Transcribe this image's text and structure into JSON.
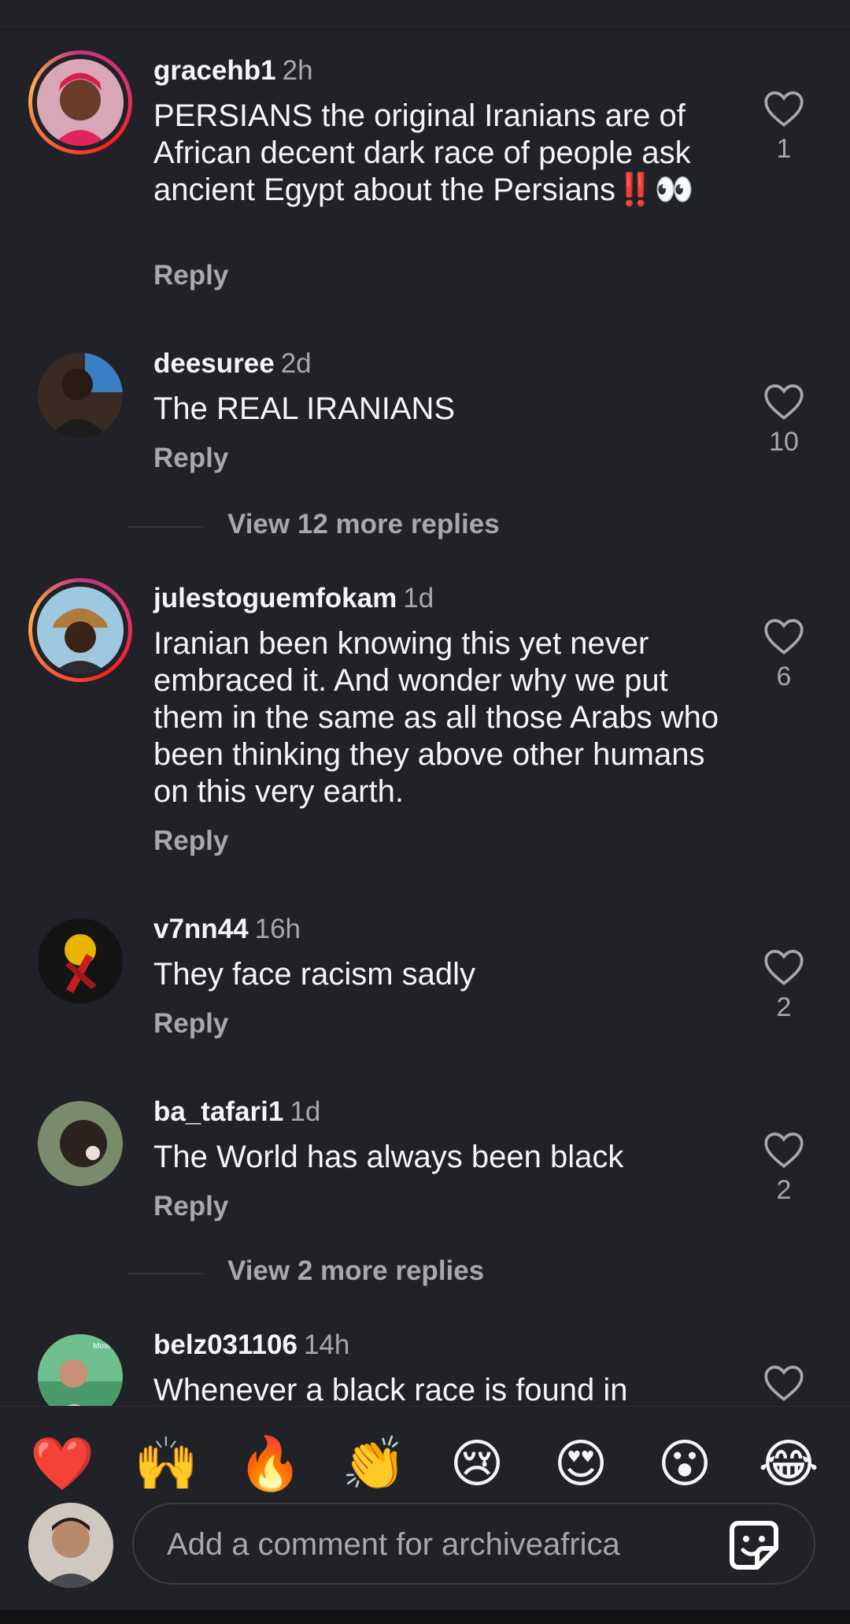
{
  "comments": [
    {
      "username": "gracehb1",
      "time": "2h",
      "text": "PERSIANS the original Iranians are of African decent dark race of people ask ancient Egypt about the Persians",
      "text_emoji": "‼️👀",
      "reply_label": "Reply",
      "likes": "1",
      "ring": true
    },
    {
      "username": "deesuree",
      "time": "2d",
      "text": "The REAL IRANIANS",
      "reply_label": "Reply",
      "likes": "10",
      "ring": false
    },
    {
      "username": "julestoguemfokam",
      "time": "1d",
      "text": "Iranian been knowing this yet never embraced it. And wonder why we put them in the same as all those Arabs who been thinking they above other humans on this very earth.",
      "reply_label": "Reply",
      "likes": "6",
      "ring": true
    },
    {
      "username": "v7nn44",
      "time": "16h",
      "text": "They face racism sadly",
      "reply_label": "Reply",
      "likes": "2",
      "ring": false
    },
    {
      "username": "ba_tafari1",
      "time": "1d",
      "text": "The World has always been black",
      "reply_label": "Reply",
      "likes": "2",
      "ring": false
    },
    {
      "username": "belz031106",
      "time": "14h",
      "text": "Whenever a black race is found in",
      "ring": false
    }
  ],
  "view_more": [
    "View 12 more replies",
    "View 2 more replies"
  ],
  "reactions": [
    "❤️",
    "🙌",
    "🔥",
    "👏",
    "😢",
    "😍",
    "😮",
    "😂"
  ],
  "composer": {
    "placeholder": "Add a comment for archiveafrica",
    "value": ""
  },
  "avatar_badge_text": "Most"
}
